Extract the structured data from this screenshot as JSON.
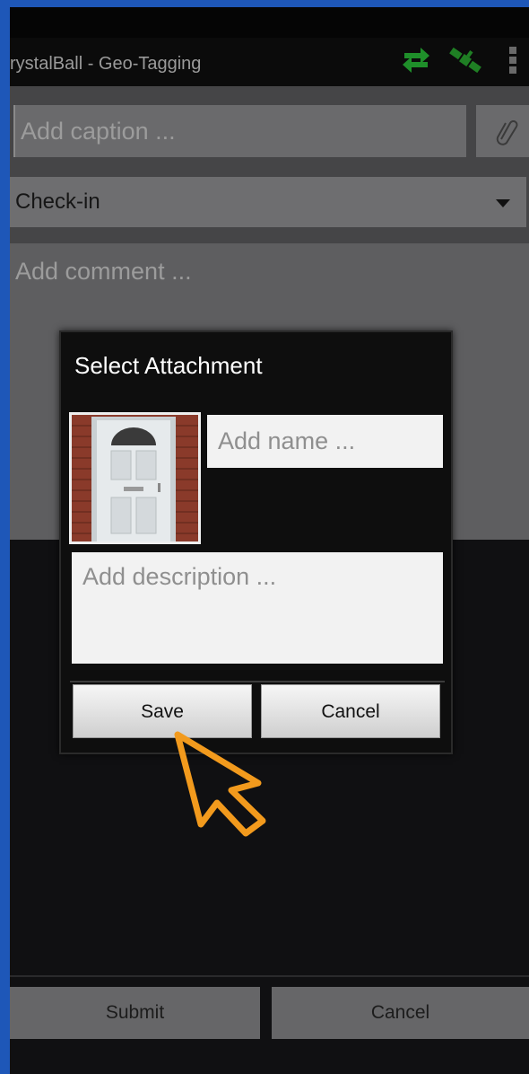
{
  "app_bar": {
    "title": "rystalBall - Geo-Tagging",
    "sync_icon": "sync-arrows-icon",
    "gps_icon": "satellite-icon",
    "menu_icon": "overflow-menu-icon",
    "accent_color": "#1f8f2a"
  },
  "form": {
    "caption_placeholder": "Add caption ...",
    "checkin_value": "Check-in",
    "comment_placeholder": "Add comment ...",
    "submit_label": "Submit",
    "cancel_label": "Cancel"
  },
  "dialog": {
    "title": "Select Attachment",
    "name_placeholder": "Add name ...",
    "description_placeholder": "Add description ...",
    "save_label": "Save",
    "cancel_label": "Cancel"
  },
  "cursor_color": "#f29a1d"
}
